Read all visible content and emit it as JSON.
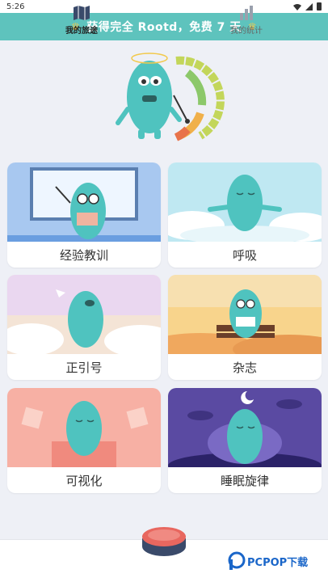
{
  "status_bar": {
    "time": "5:26"
  },
  "promo": {
    "text": "获得完全 Rootd，免费 7 天"
  },
  "cards": [
    {
      "label": "经验教训"
    },
    {
      "label": "呼吸"
    },
    {
      "label": "正引号"
    },
    {
      "label": "杂志"
    },
    {
      "label": "可视化"
    },
    {
      "label": "睡眠旋律"
    }
  ],
  "bottom_nav": {
    "journey_label": "我的旅途",
    "stats_label": "我的统计"
  },
  "watermark": {
    "text": "PCPOP下载"
  },
  "colors": {
    "teal": "#5ec3bd",
    "monster": "#4fc3bf",
    "start_button": "#e8675f"
  }
}
